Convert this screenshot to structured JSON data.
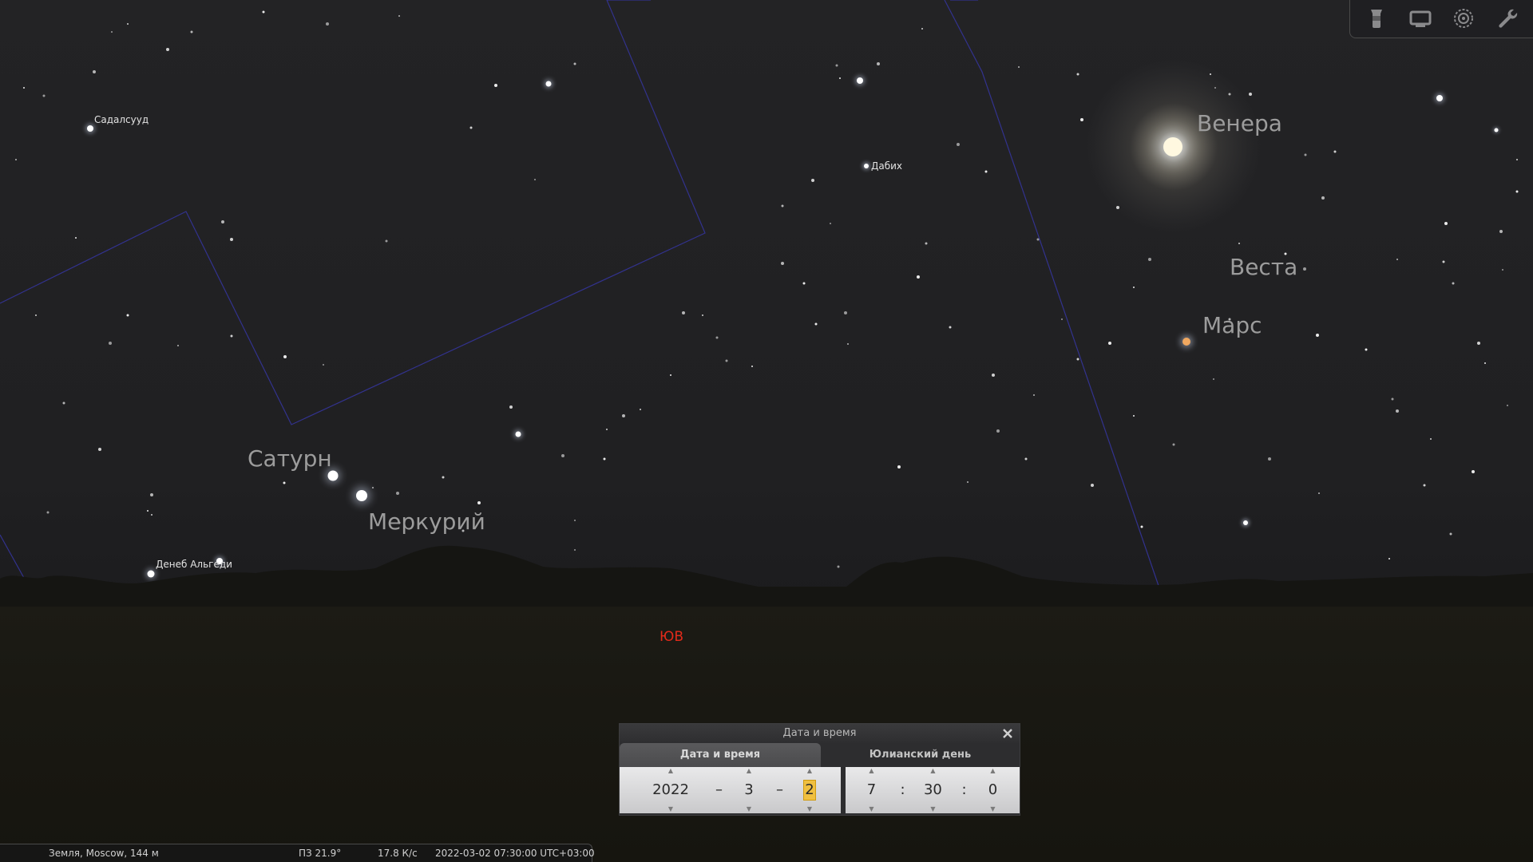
{
  "sky": {
    "labels": {
      "sadalsuud": "Садалсууд",
      "dabih": "Дабих",
      "deneb_algedi": "Денеб Альгеди"
    },
    "planets": {
      "venus": "Венера",
      "vesta": "Веста",
      "mars": "Марс",
      "saturn": "Сатурн",
      "mercury": "Меркурий"
    },
    "cardinal": "ЮВ"
  },
  "toolbar": {
    "icons": [
      "lantern-icon",
      "screen-icon",
      "target-icon",
      "wrench-icon"
    ]
  },
  "datetime_dialog": {
    "title": "Дата и время",
    "tabs": [
      {
        "label": "Дата и время",
        "active": true
      },
      {
        "label": "Юлианский день",
        "active": false
      }
    ],
    "date": {
      "year": "2022",
      "month": "3",
      "day": "2",
      "separator": "–"
    },
    "time": {
      "hour": "7",
      "minute": "30",
      "second": "0",
      "separator": ":"
    }
  },
  "statusbar": {
    "location": "Земля, Moscow, 144 м",
    "fov": "ПЗ 21.9°",
    "fps": "17.8 К/с",
    "datetime": "2022-03-02 07:30:00 UTC+03:00"
  },
  "colors": {
    "cardinal_label": "#e22a1a",
    "constellation_lines": "#3a3aa0",
    "mars": "#f0a860",
    "venus_glow": "#fff8e0"
  }
}
